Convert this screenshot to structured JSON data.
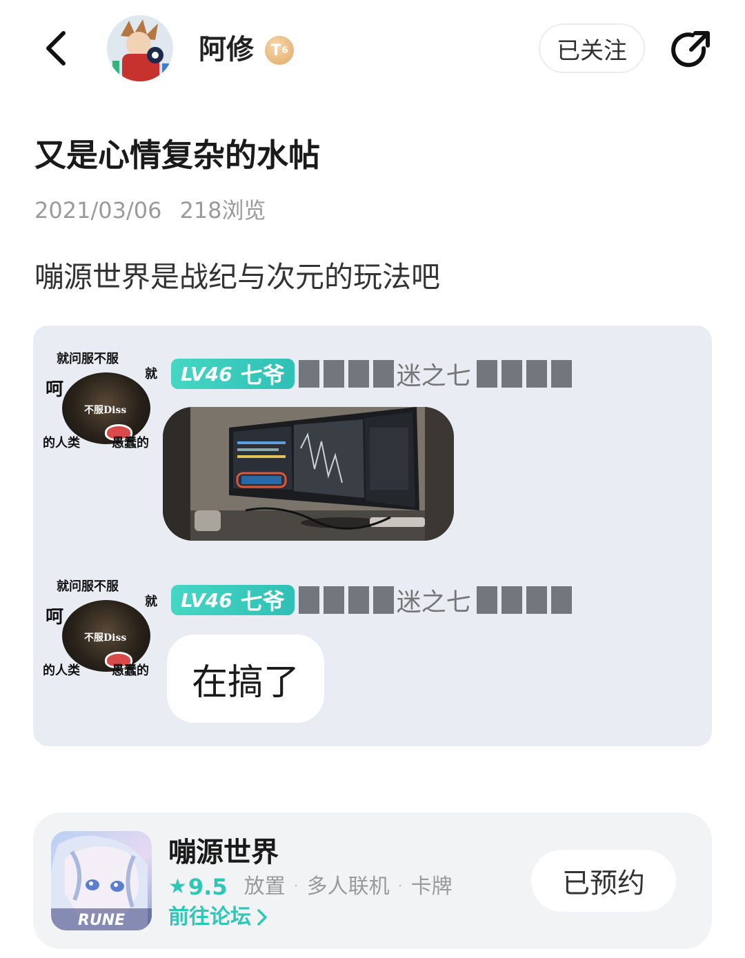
{
  "header": {
    "author_name": "阿修",
    "level_badge": "T",
    "level_badge_sub": "6",
    "follow_label": "已关注",
    "back_icon": "chevron-left-icon",
    "share_icon": "share-icon"
  },
  "post": {
    "title": "又是心情复杂的水帖",
    "date": "2021/03/06",
    "views": "218浏览",
    "body": "嘣源世界是战纪与次元的玩法吧"
  },
  "embed": {
    "messages": [
      {
        "avatar_top_text": "就问服不服",
        "avatar_right_text": "就",
        "avatar_left_text": "呵",
        "avatar_mid_text": "不服Diss",
        "avatar_bottom_left": "的人类",
        "avatar_bottom_right": "愚蠢的",
        "level": "LV46",
        "rank": "七爷",
        "nick_visible": "迷之七",
        "content_type": "image"
      },
      {
        "avatar_top_text": "就问服不服",
        "avatar_right_text": "就",
        "avatar_left_text": "呵",
        "avatar_mid_text": "不服Diss",
        "avatar_bottom_left": "的人类",
        "avatar_bottom_right": "愚蠢的",
        "level": "LV46",
        "rank": "七爷",
        "nick_visible": "迷之七",
        "content_type": "text",
        "text": "在搞了"
      }
    ]
  },
  "game_card": {
    "name": "嘣源世界",
    "rating": "9.5",
    "tags": [
      "放置",
      "多人联机",
      "卡牌"
    ],
    "forum_link": "前往论坛",
    "reserve_label": "已预约",
    "icon_text": "RUNE",
    "accent_color": "#2ec7b5"
  }
}
